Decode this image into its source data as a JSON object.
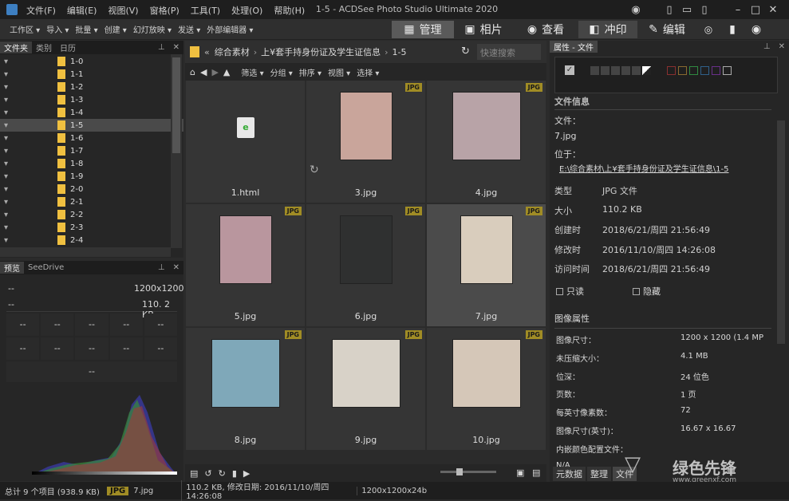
{
  "app": {
    "title": "1-5 - ACDSee Photo Studio Ultimate 2020",
    "menu": [
      "文件(F)",
      "编辑(E)",
      "视图(V)",
      "窗格(P)",
      "工具(T)",
      "处理(O)",
      "帮助(H)"
    ]
  },
  "toolbar": {
    "items": [
      "工作区 ▾",
      "导入 ▾",
      "批量 ▾",
      "创建 ▾",
      "幻灯放映 ▾",
      "发送 ▾",
      "外部编辑器 ▾"
    ],
    "modes": [
      "管理",
      "相片",
      "查看",
      "冲印",
      "编辑"
    ]
  },
  "folders_panel": {
    "tabs": [
      "文件夹",
      "类别",
      "日历"
    ],
    "items": [
      "1-0",
      "1-1",
      "1-2",
      "1-3",
      "1-4",
      "1-5",
      "1-6",
      "1-7",
      "1-8",
      "1-9",
      "2-0",
      "2-1",
      "2-2",
      "2-3",
      "2-4"
    ],
    "selected": "1-5"
  },
  "preview_panel": {
    "tabs": [
      "预览",
      "SeeDrive"
    ],
    "dimensions": "1200x1200",
    "size": "110. 2 KB",
    "dashes": "--"
  },
  "browser": {
    "breadcrumb": [
      "综合素材",
      "上¥套手持身份证及学生证信息",
      "1-5"
    ],
    "search_placeholder": "快速搜索",
    "filter_bar": [
      "筛选 ▾",
      "分组 ▾",
      "排序 ▾",
      "视图 ▾",
      "选择 ▾"
    ],
    "files": [
      {
        "name": "1.html",
        "tag": "",
        "color": "#353535"
      },
      {
        "name": "3.jpg",
        "tag": "JPG",
        "color": "#c9a59b"
      },
      {
        "name": "4.jpg",
        "tag": "JPG",
        "color": "#b8a3a7"
      },
      {
        "name": "5.jpg",
        "tag": "JPG",
        "color": "#b9969e"
      },
      {
        "name": "6.jpg",
        "tag": "JPG",
        "color": "#2f3030"
      },
      {
        "name": "7.jpg",
        "tag": "JPG",
        "color": "#d9cdbd"
      },
      {
        "name": "8.jpg",
        "tag": "JPG",
        "color": "#7fa8b9"
      },
      {
        "name": "9.jpg",
        "tag": "JPG",
        "color": "#d8d2c8"
      },
      {
        "name": "10.jpg",
        "tag": "JPG",
        "color": "#d5c7b8"
      }
    ]
  },
  "properties": {
    "title": "属性 - 文件",
    "section_file": "文件信息",
    "file_label": "文件：",
    "file_value": "7.jpg",
    "location_label": "位于：",
    "location_value": "E:\\综合素材\\上¥套手持身份证及学生证信息\\1-5",
    "rows": [
      {
        "label": "类型",
        "value": "JPG 文件"
      },
      {
        "label": "大小",
        "value": "110.2 KB"
      },
      {
        "label": "创建时",
        "value": "2018/6/21/周四 21:56:49"
      },
      {
        "label": "修改时",
        "value": "2016/11/10/周四 14:26:08"
      },
      {
        "label": "访问时间",
        "value": "2018/6/21/周四 21:56:49"
      }
    ],
    "readonly": "只读",
    "hidden": "隐藏",
    "section_image": "图像属性",
    "image_rows": [
      {
        "label": "图像尺寸：",
        "value": "1200 x 1200 (1.4 MP"
      },
      {
        "label": "未压缩大小：",
        "value": "4.1 MB"
      },
      {
        "label": "位深：",
        "value": "24 位色"
      },
      {
        "label": "页数：",
        "value": "1 页"
      },
      {
        "label": "每英寸像素数：",
        "value": "72"
      },
      {
        "label": "图像尺寸(英寸)：",
        "value": "16.67 x 16.67"
      },
      {
        "label": "内嵌颜色配置文件：",
        "value": ""
      },
      {
        "label": "N/A",
        "value": ""
      }
    ],
    "bottom_tabs": [
      "元数据",
      "整理",
      "文件"
    ],
    "watermark": "绿色先锋",
    "watermark_url": "www.greenxf.com"
  },
  "status": {
    "total": "总计 9 个项目 (938.9 KB)",
    "badge": "JPG",
    "file": "7.jpg",
    "info": "110.2 KB, 修改日期: 2016/11/10/周四 14:26:08",
    "dims": "1200x1200x24b"
  },
  "colors": {
    "accent": "#a08c25",
    "link": "#d8d8d8",
    "folder": "#f0c040"
  }
}
